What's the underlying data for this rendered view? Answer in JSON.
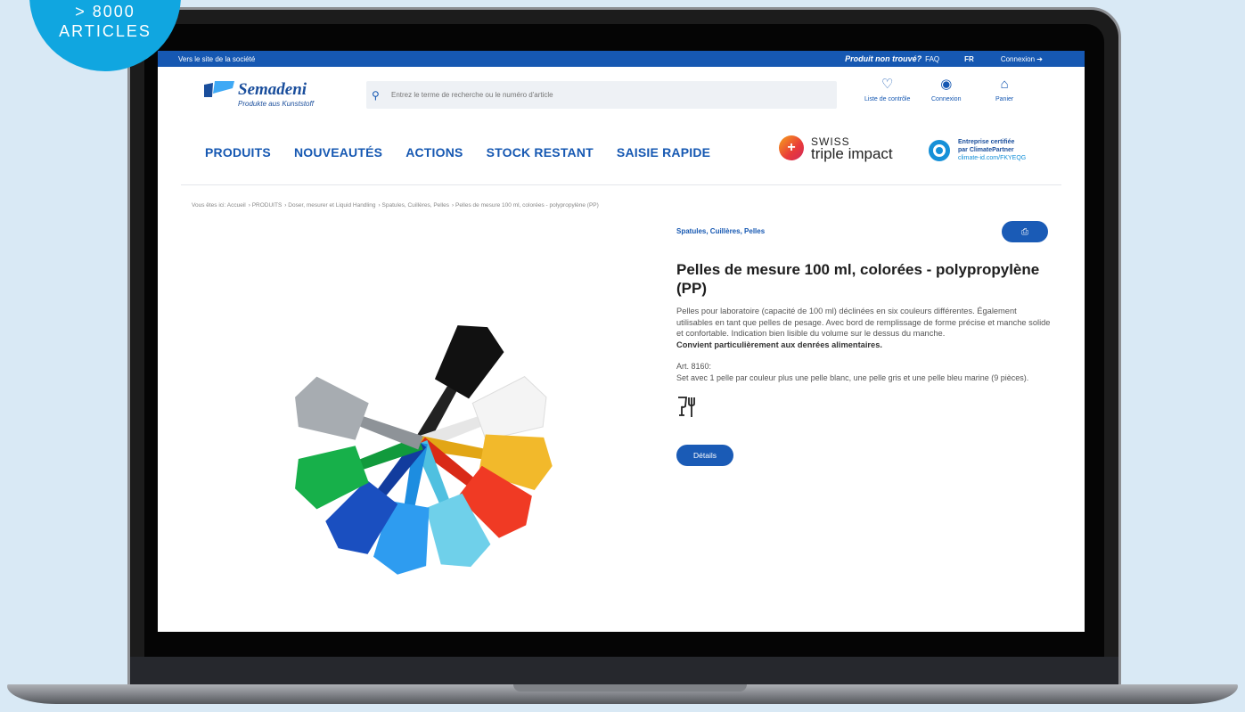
{
  "promo": {
    "line1": "> 8000",
    "line2": "ARTICLES"
  },
  "topbar": {
    "company_link": "Vers le site de la société",
    "not_found": "Produit non trouvé?",
    "faq": "FAQ",
    "lang": "FR",
    "login": "Connexion"
  },
  "brand": {
    "name": "Semadeni",
    "tagline": "Produkte aus Kunststoff"
  },
  "search": {
    "placeholder": "Entrez le terme de recherche ou le numéro d'article"
  },
  "header_icons": {
    "watchlist": "Liste de contrôle",
    "account": "Connexion",
    "cart": "Panier"
  },
  "nav": [
    "PRODUITS",
    "NOUVEAUTÉS",
    "ACTIONS",
    "STOCK RESTANT",
    "SAISIE RAPIDE"
  ],
  "partners": {
    "sti_line1": "SWISS",
    "sti_line2": "triple impact",
    "cp_line1": "Entreprise certifiée",
    "cp_line2": "par ClimatePartner",
    "cp_url": "climate-id.com/FKYEQG"
  },
  "breadcrumb": [
    "Vous êtes ici: Accueil",
    "PRODUITS",
    "Doser, mesurer et Liquid Handling",
    "Spatules, Cuillères, Pelles",
    "Pelles de mesure 100 ml, colorées - polypropylène (PP)"
  ],
  "product": {
    "category": "Spatules, Cuillères, Pelles",
    "title": "Pelles de mesure 100 ml, colorées - polypropylène (PP)",
    "description": "Pelles pour laboratoire (capacité de 100 ml) déclinées en six couleurs différentes. Également utilisables en tant que pelles de pesage. Avec bord de remplissage de forme précise et manche solide et confortable. Indication bien lisible du volume sur le dessus du manche.",
    "description_bold": "Convient particulièrement aux denrées alimentaires.",
    "art_number": "Art. 8160:",
    "art_text": "Set avec 1 pelle par couleur plus une pelle blanc, une pelle gris et une pelle bleu marine (9 pièces).",
    "details_button": "Détails"
  },
  "colors": {
    "primary": "#1658b2",
    "promo": "#10a6e0",
    "background": "#d9e9f5"
  }
}
